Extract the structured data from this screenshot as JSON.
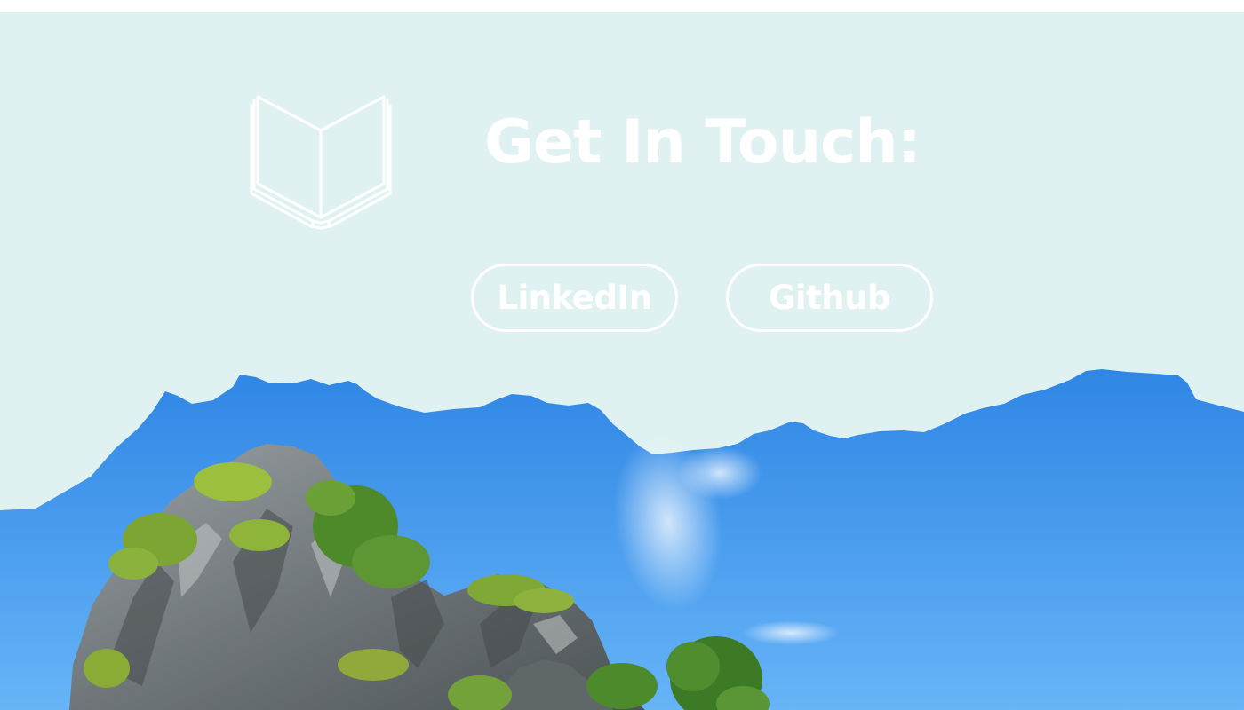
{
  "contact": {
    "title": "Get In Touch:",
    "buttons": [
      {
        "label": "LinkedIn",
        "icon": ""
      },
      {
        "label": "Github",
        "icon": ""
      }
    ]
  },
  "icons": {
    "hero_icon": "open-book-icon"
  },
  "colors": {
    "page_background": "#dff1f1",
    "text": "#ffffff",
    "sky": "#3b90e8",
    "rock": "#7b8183",
    "foliage": "#5f8d2e"
  }
}
